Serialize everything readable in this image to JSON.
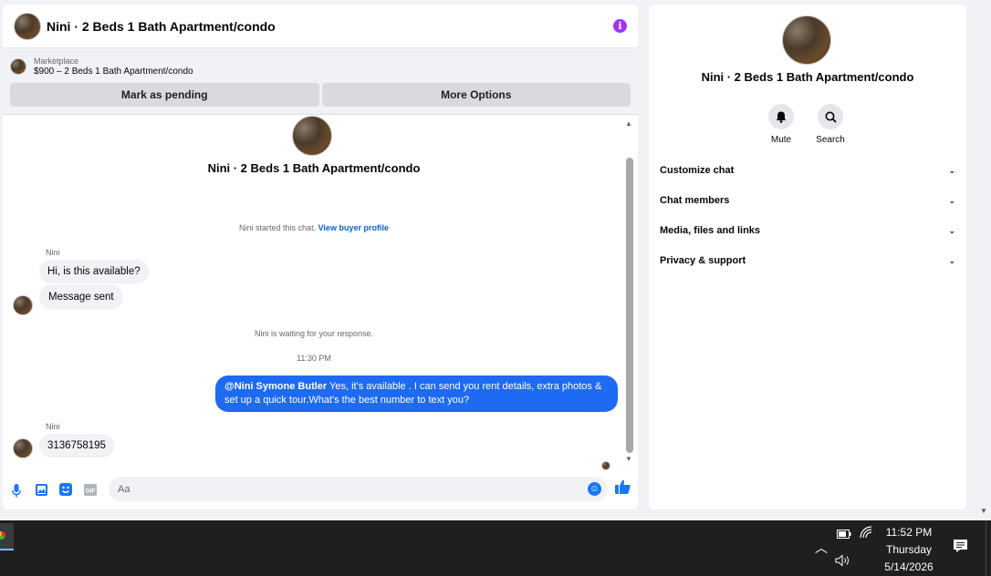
{
  "chat": {
    "title": "Nini · 2 Beds 1 Bath Apartment/condo",
    "info_icon": "i",
    "marketplace": {
      "label": "Marketplace",
      "listing": "$900 – 2 Beds 1 Bath Apartment/condo",
      "mark_pending": "Mark as pending",
      "more_options": "More Options"
    },
    "conversation_title": "Nini · 2 Beds 1 Bath Apartment/condo",
    "started_text": "Nini started this chat.",
    "buyer_profile_link": "View buyer profile",
    "messages": [
      {
        "sender": "Nini",
        "text": "Hi, is this available?"
      },
      {
        "sender": "",
        "text": "Message sent"
      }
    ],
    "waiting_text": "Nini is waiting for your response.",
    "timestamp": "11:30 PM",
    "outgoing": {
      "mention": "@Nini Symone Butler",
      "text": " Yes, it's available .  I can send you rent details, extra photos & set up a quick tour.What's the best number to text you?"
    },
    "reply": {
      "sender": "Nini",
      "text": "3136758195"
    },
    "composer_placeholder": "Aa"
  },
  "side": {
    "title": "Nini · 2 Beds 1 Bath Apartment/condo",
    "actions": {
      "mute": "Mute",
      "search": "Search"
    },
    "sections": [
      "Customize chat",
      "Chat members",
      "Media, files and links",
      "Privacy & support"
    ]
  },
  "taskbar": {
    "time": "11:52 PM",
    "day": "Thursday",
    "date": "5/14/2026"
  },
  "colors": {
    "accent": "#1877f2",
    "outgoing_bubble": "#1f6af2",
    "info": "#a033ff"
  }
}
